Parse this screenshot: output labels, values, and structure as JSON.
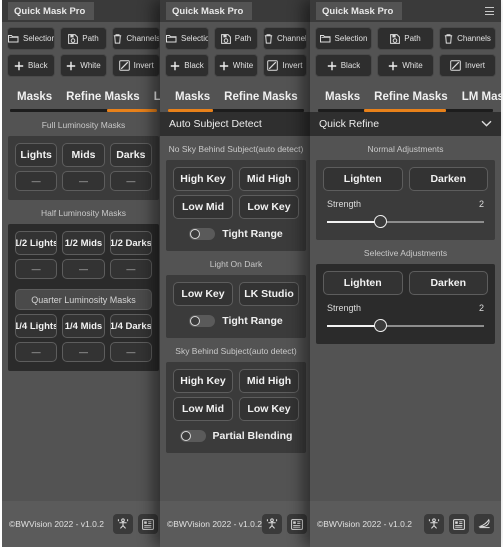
{
  "app": {
    "title": "Quick Mask Pro",
    "menu_icon": "hamburger-icon",
    "accent_color": "#e8811a",
    "panel_bg": "#535353",
    "card_bg": "#3b3b3b",
    "button_bg": "#333333"
  },
  "toolbar": {
    "row1": [
      {
        "label": "Selection",
        "icon": "folder-icon"
      },
      {
        "label": "Path",
        "icon": "save-path-icon"
      },
      {
        "label": "Channels",
        "icon": "trash-icon"
      }
    ],
    "row2": [
      {
        "label": "Black",
        "icon": "plus-icon"
      },
      {
        "label": "White",
        "icon": "plus-icon"
      },
      {
        "label": "Invert",
        "icon": "invert-icon"
      }
    ]
  },
  "tabs": [
    {
      "label": "Masks"
    },
    {
      "label": "Refine Masks"
    },
    {
      "label": "LM Masks"
    }
  ],
  "panels": [
    {
      "id": "panel-masks-lm",
      "active_tab": "LM Masks",
      "active_tab_index": 2,
      "sections": [
        {
          "title": "Full Luminosity Masks",
          "type": "group-label",
          "buttons": [
            "Lights",
            "Mids",
            "Darks"
          ],
          "sub_buttons": [
            "—",
            "—",
            "—"
          ]
        },
        {
          "title": "Half Luminosity Masks",
          "type": "group-label",
          "buttons": [
            "1/2 Lights",
            "1/2 Mids",
            "1/2 Darks"
          ],
          "sub_buttons": [
            "—",
            "—",
            "—"
          ]
        },
        {
          "title": "Quarter Luminosity Masks",
          "type": "group-label",
          "buttons": [
            "1/4 Lights",
            "1/4 Mids",
            "1/4 Darks"
          ],
          "sub_buttons": [
            "—",
            "—",
            "—"
          ]
        }
      ],
      "footer": {
        "copyright": "©BWVision 2022 - v1.0.2",
        "icons": [
          "person-tool-icon",
          "panel-list-icon"
        ]
      }
    },
    {
      "id": "panel-masks",
      "active_tab": "Masks",
      "active_tab_index": 0,
      "section_header": {
        "title": "Auto Subject Detect",
        "chevron": "chevron-down-icon"
      },
      "groups": [
        {
          "label": "No Sky Behind Subject(auto detect)",
          "buttons_row1": [
            "High Key",
            "Mid High"
          ],
          "buttons_row2": [
            "Low Mid",
            "Low Key"
          ],
          "toggle": {
            "label": "Tight Range",
            "on": false
          }
        },
        {
          "label": "Light On Dark",
          "buttons_row1": [
            "Low Key",
            "LK Studio"
          ],
          "toggle": {
            "label": "Tight Range",
            "on": false
          }
        },
        {
          "label": "Sky Behind Subject(auto detect)",
          "buttons_row1": [
            "High Key",
            "Mid High"
          ],
          "buttons_row2": [
            "Low Mid",
            "Low Key"
          ],
          "toggle": {
            "label": "Partial Blending",
            "on": false
          }
        }
      ],
      "footer": {
        "copyright": "©BWVision 2022 - v1.0.2",
        "icons": [
          "person-tool-icon",
          "panel-list-icon"
        ]
      }
    },
    {
      "id": "panel-refine-masks",
      "active_tab": "Refine Masks",
      "active_tab_index": 1,
      "section_header": {
        "title": "Quick Refine",
        "chevron": "chevron-down-icon"
      },
      "groups": [
        {
          "label": "Normal Adjustments",
          "buttons": [
            "Lighten",
            "Darken"
          ],
          "slider": {
            "label": "Strength",
            "value": "2",
            "percent": 34
          }
        },
        {
          "label": "Selective Adjustments",
          "buttons": [
            "Lighten",
            "Darken"
          ],
          "slider": {
            "label": "Strength",
            "value": "2",
            "percent": 34
          }
        }
      ],
      "footer": {
        "copyright": "©BWVision 2022 - v1.0.2",
        "icons": [
          "person-tool-icon",
          "panel-list-icon",
          "eraser-icon"
        ]
      }
    }
  ]
}
